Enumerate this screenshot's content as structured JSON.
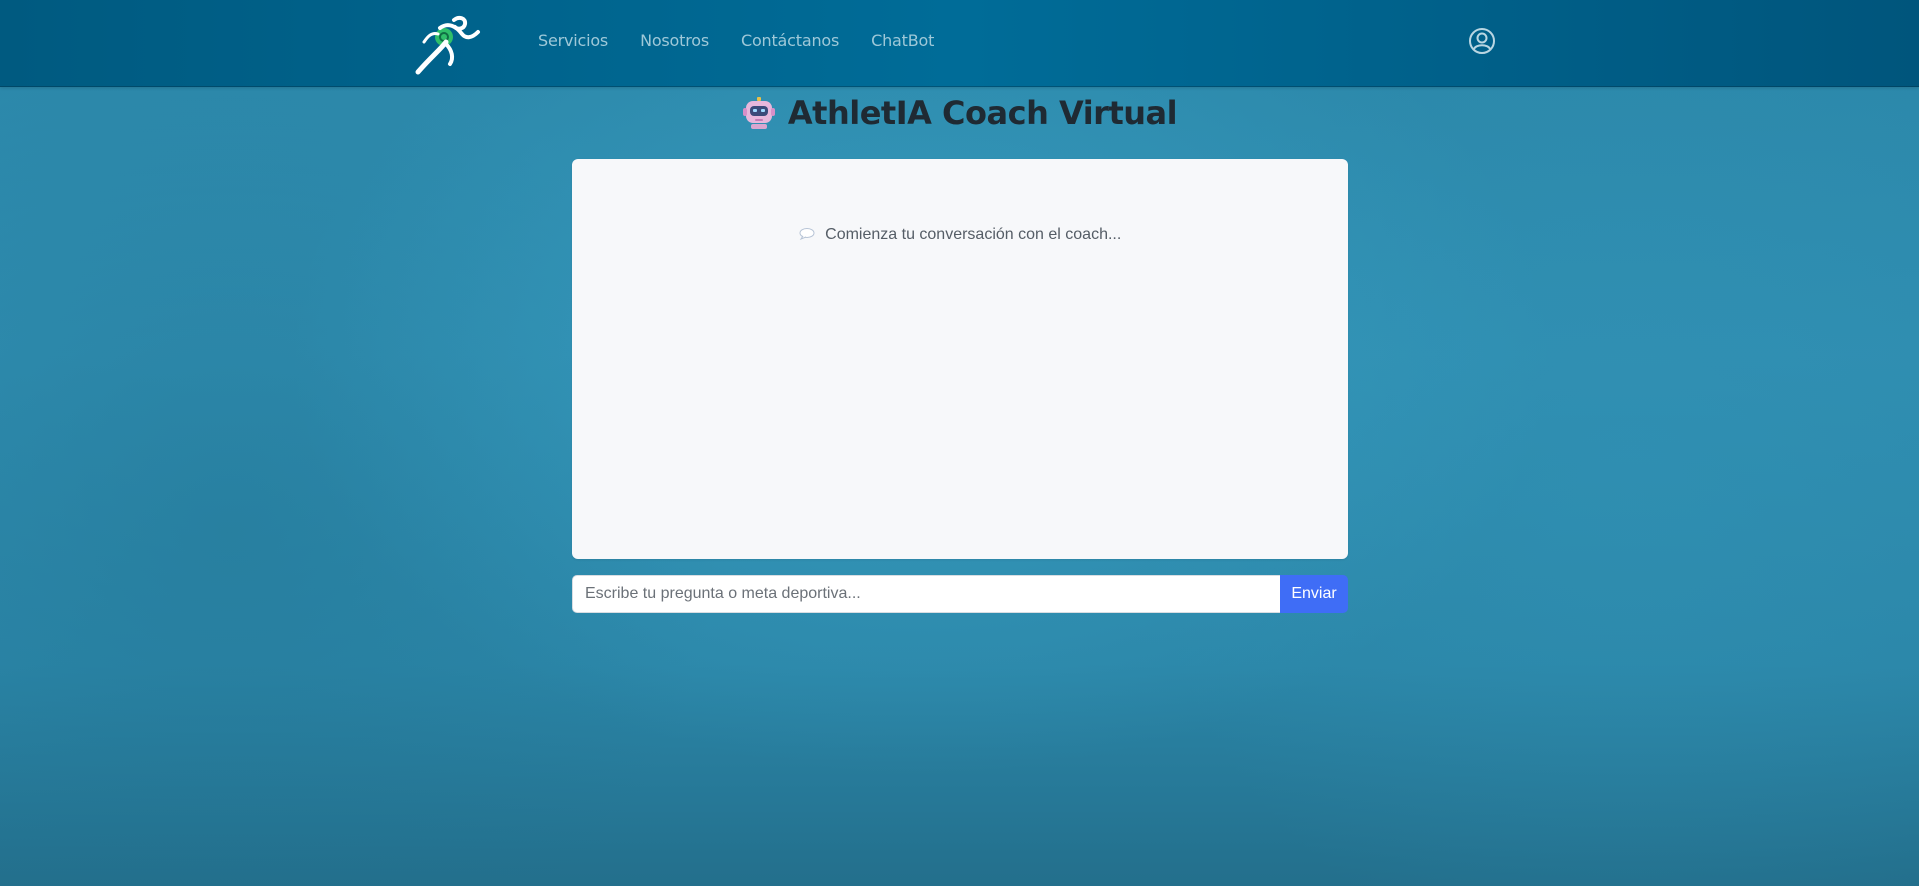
{
  "nav": {
    "logo_icon": "runner-logo-icon",
    "links": [
      "Servicios",
      "Nosotros",
      "Contáctanos",
      "ChatBot"
    ],
    "user_icon": "user-circle-icon"
  },
  "header": {
    "icon": "robot-icon",
    "title": "AthletIA Coach Virtual"
  },
  "chat": {
    "empty_icon": "speech-bubble-icon",
    "empty_text": "Comienza tu conversación con el coach..."
  },
  "composer": {
    "value": "",
    "placeholder": "Escribe tu pregunta o meta deportiva...",
    "send_label": "Enviar"
  },
  "colors": {
    "nav_bg": "#006c98",
    "page_bg": "#2f8db0",
    "send_button": "#3f6df6",
    "logo_accent": "#2fbf6a"
  }
}
